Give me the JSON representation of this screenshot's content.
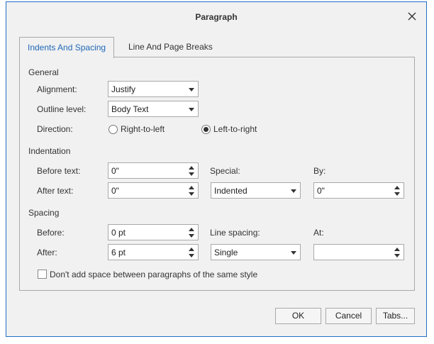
{
  "dialog": {
    "title": "Paragraph"
  },
  "tabs": [
    {
      "label": "Indents And Spacing",
      "active": true
    },
    {
      "label": "Line And Page Breaks",
      "active": false
    }
  ],
  "general": {
    "heading": "General",
    "alignment": {
      "label": "Alignment:",
      "value": "Justify"
    },
    "outline_level": {
      "label": "Outline level:",
      "value": "Body Text"
    },
    "direction": {
      "label": "Direction:",
      "options": [
        {
          "label": "Right-to-left",
          "selected": false
        },
        {
          "label": "Left-to-right",
          "selected": true
        }
      ]
    }
  },
  "indentation": {
    "heading": "Indentation",
    "before_text": {
      "label": "Before text:",
      "value": "0\""
    },
    "after_text": {
      "label": "After text:",
      "value": "0\""
    },
    "special": {
      "label": "Special:",
      "value": "Indented"
    },
    "by": {
      "label": "By:",
      "value": "0\""
    }
  },
  "spacing": {
    "heading": "Spacing",
    "before": {
      "label": "Before:",
      "value": "0 pt"
    },
    "after": {
      "label": "After:",
      "value": "6 pt"
    },
    "line_spacing": {
      "label": "Line spacing:",
      "value": "Single"
    },
    "at": {
      "label": "At:",
      "value": ""
    },
    "dont_add_space": {
      "label": "Don't add space between paragraphs of the same style",
      "checked": false
    }
  },
  "buttons": {
    "ok": "OK",
    "cancel": "Cancel",
    "tabs": "Tabs..."
  },
  "colors": {
    "accent": "#1e67b7",
    "border": "#a9a9a9",
    "background": "#f1f1f1"
  }
}
